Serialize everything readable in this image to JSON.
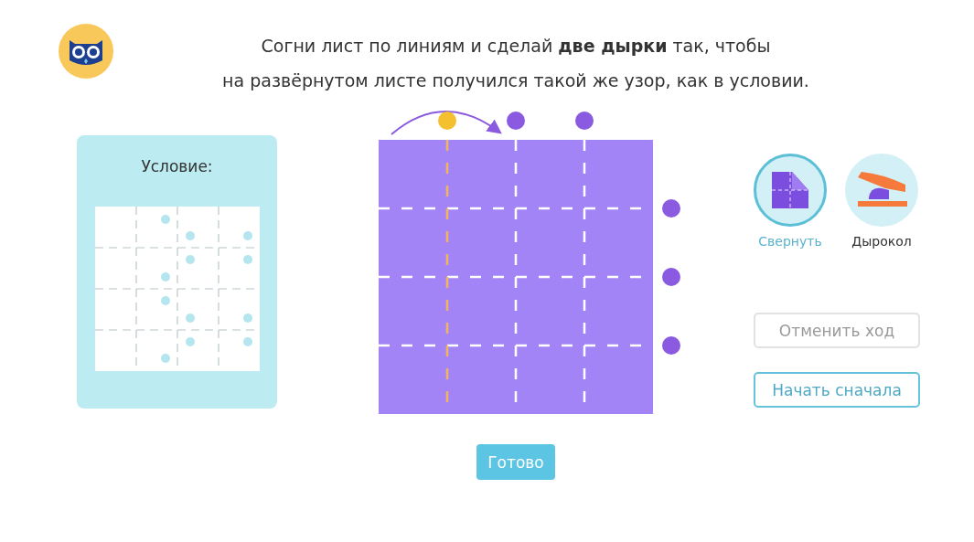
{
  "instruction": {
    "lines": [
      "Согни лист по линиям и сделай **две дырки** так, чтобы",
      "на развёрнутом листе получился такой же узор, как в условии."
    ]
  },
  "condition": {
    "title": "Условие:"
  },
  "fold_columns": [
    {
      "selected": true
    },
    {
      "selected": false
    },
    {
      "selected": false
    }
  ],
  "fold_rows": [
    {
      "selected": false
    },
    {
      "selected": false
    },
    {
      "selected": false
    }
  ],
  "tools": [
    {
      "kind": "fold",
      "label": "Свернуть",
      "selected": true
    },
    {
      "kind": "punch",
      "label": "Дырокол",
      "selected": false
    }
  ],
  "buttons": [
    {
      "label": "Отменить ход",
      "disabled": true
    },
    {
      "label": "Начать сначала",
      "disabled": false
    }
  ],
  "done_button": {
    "label": "Готово"
  }
}
